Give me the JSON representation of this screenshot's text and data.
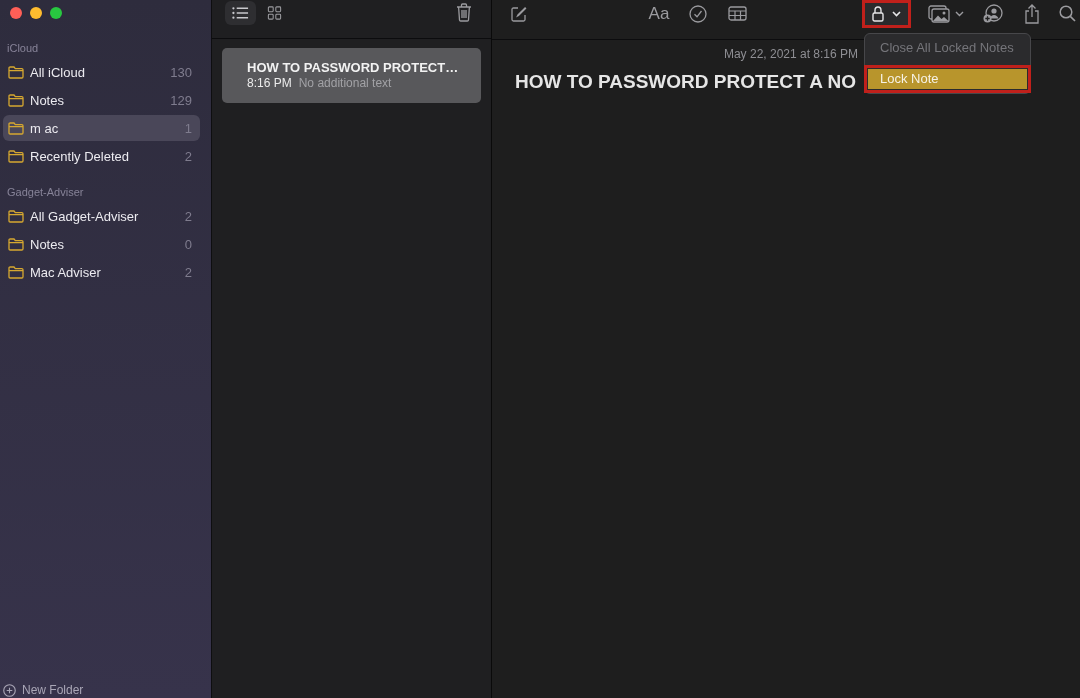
{
  "sidebar": {
    "groups": [
      {
        "title": "iCloud",
        "items": [
          {
            "name": "All iCloud",
            "count": "130",
            "selected": false
          },
          {
            "name": "Notes",
            "count": "129",
            "selected": false
          },
          {
            "name": "m ac",
            "count": "1",
            "selected": true
          },
          {
            "name": "Recently Deleted",
            "count": "2",
            "selected": false
          }
        ]
      },
      {
        "title": "Gadget-Adviser",
        "items": [
          {
            "name": "All Gadget-Adviser",
            "count": "2",
            "selected": false
          },
          {
            "name": "Notes",
            "count": "0",
            "selected": false
          },
          {
            "name": "Mac Adviser",
            "count": "2",
            "selected": false
          }
        ]
      }
    ],
    "new_folder": "New Folder"
  },
  "note_list": {
    "view_modes": [
      {
        "kind": "list",
        "selected": true
      },
      {
        "kind": "gallery",
        "selected": false
      }
    ],
    "notes": [
      {
        "title": "HOW TO PASSWORD PROTECT…",
        "time": "8:16 PM",
        "preview": "No additional text",
        "selected": true
      }
    ]
  },
  "editor": {
    "toolbar": {
      "format_button": "Aa",
      "lock_button": {
        "outlined": true
      }
    },
    "date": "May 22, 2021 at 8:16 PM",
    "title": "HOW TO PASSWORD PROTECT A NO",
    "lock_menu": {
      "items": [
        {
          "label": "Close All Locked Notes",
          "disabled": true,
          "selected": false,
          "outlined": false
        },
        {
          "label": "Lock Note",
          "disabled": false,
          "selected": true,
          "outlined": true
        }
      ]
    }
  }
}
